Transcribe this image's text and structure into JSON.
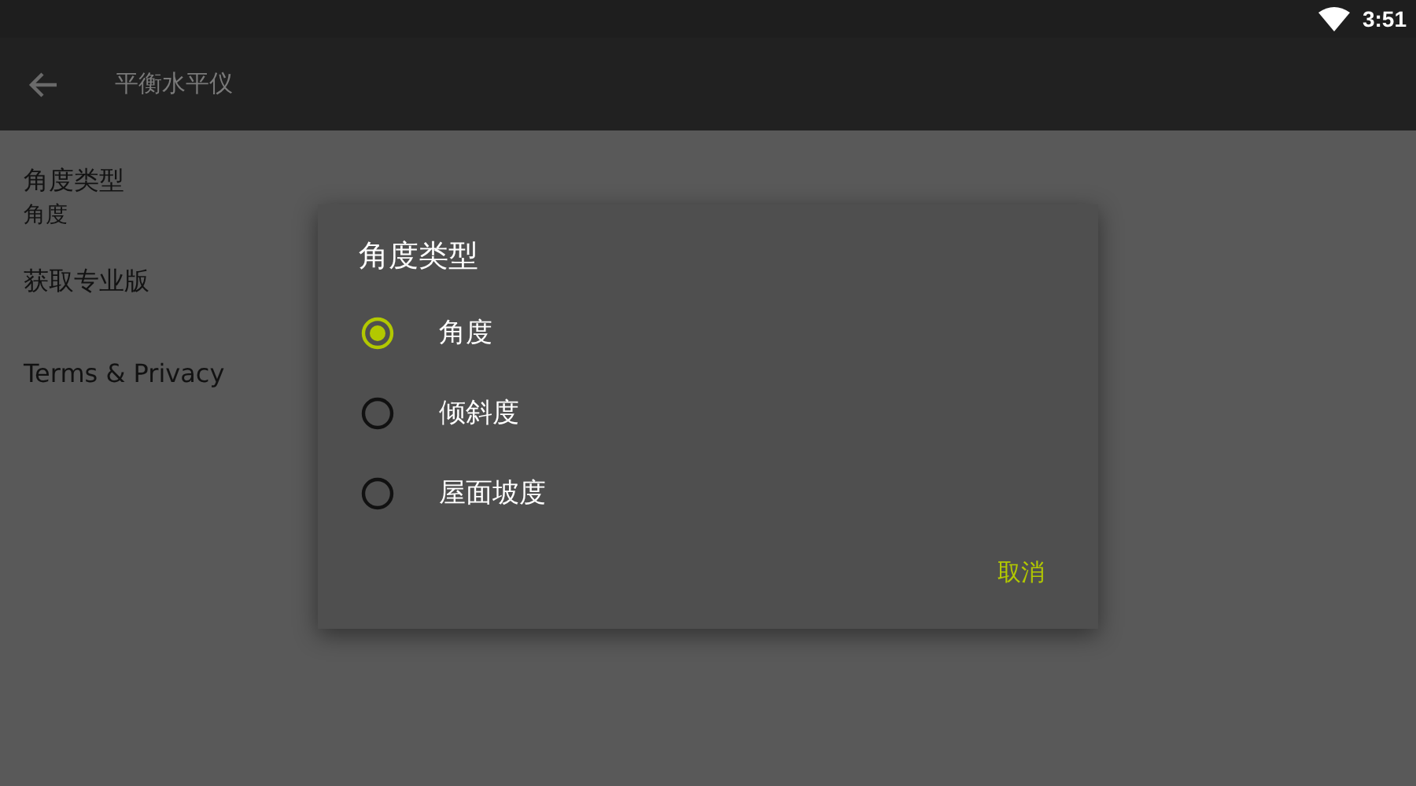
{
  "status_bar": {
    "time": "3:51"
  },
  "app_bar": {
    "title": "平衡水平仪"
  },
  "settings": [
    {
      "title": "角度类型",
      "summary": "角度"
    },
    {
      "title": "获取专业版"
    },
    {
      "title": "Terms & Privacy"
    }
  ],
  "dialog": {
    "title": "角度类型",
    "options": [
      {
        "label": "角度",
        "selected": true
      },
      {
        "label": "倾斜度",
        "selected": false
      },
      {
        "label": "屋面坡度",
        "selected": false
      }
    ],
    "buttons": [
      "取消"
    ]
  }
}
